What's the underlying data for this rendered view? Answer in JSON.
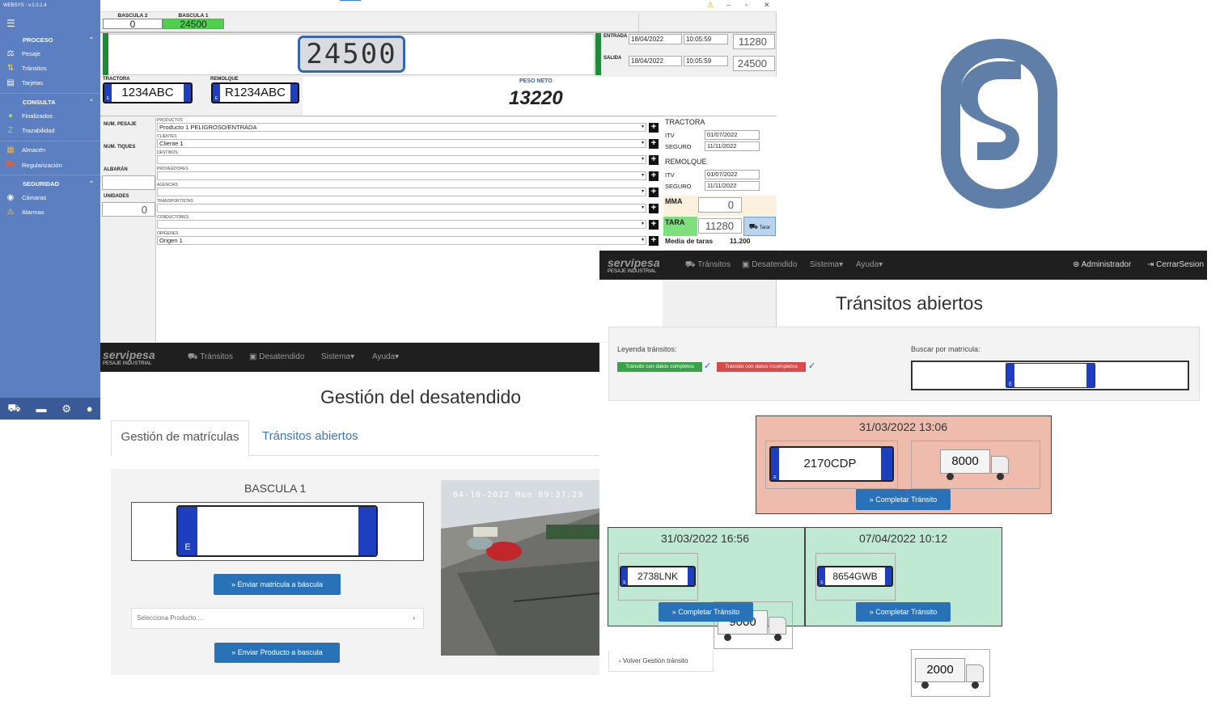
{
  "desktop": {
    "version": "WEBSYS - v.1.0.1.4",
    "sections": {
      "proceso": "PROCESO",
      "consulta": "CONSULTA",
      "seguridad": "SEGURIDAD"
    },
    "menu": {
      "pesaje": "Pesaje",
      "transitos": "Tránsitos",
      "tarjetas": "Tarjetas",
      "finalizados": "Finalizados",
      "trazabilidad": "Trazabilidad",
      "almacen": "Almacén",
      "regularizacion": "Regularización",
      "camaras": "Cámaras",
      "alarmas": "Alarmas"
    },
    "bascula2": {
      "label": "BASCULA 2",
      "value": "0"
    },
    "bascula1": {
      "label": "BASCULA 1",
      "value": "24500"
    },
    "display": "24500",
    "entrada": {
      "label": "ENTRADA",
      "date": "18/04/2022",
      "time": "10:05:59",
      "value": "11280"
    },
    "salida": {
      "label": "SALIDA",
      "date": "18/04/2022",
      "time": "10:05:59",
      "value": "24500"
    },
    "tractora_label": "TRACTORA",
    "tractora_plate": "1234ABC",
    "remolque_label": "REMOLQUE",
    "remolque_plate": "R1234ABC",
    "peso_neto_label": "PESO NETO",
    "peso_neto": "13220",
    "left_labels": {
      "num_pesaje": "NUM. PESAJE",
      "num_tiques": "NUM. TIQUES",
      "albaran": "ALBARÁN",
      "unidades": "UNIDADES"
    },
    "unidades_value": "0",
    "fields": [
      {
        "label": "PRODUCTOS",
        "value": "Producto 1 PELIGROSO/ENTRADA"
      },
      {
        "label": "CLIENTES",
        "value": "Cliente 1"
      },
      {
        "label": "DESTINOS",
        "value": ""
      },
      {
        "label": "PROVEEDORES",
        "value": ""
      },
      {
        "label": "AGENCIAS",
        "value": ""
      },
      {
        "label": "TRANSPORTISTAS",
        "value": ""
      },
      {
        "label": "CONDUCTORES",
        "value": ""
      },
      {
        "label": "ORÍGENES",
        "value": "Origen 1"
      }
    ],
    "right": {
      "tractora": "TRACTORA",
      "remolque": "REMOLQUE",
      "itv": "ITV",
      "seguro": "SEGURO",
      "tractora_itv": "01/07/2022",
      "tractora_seguro": "11/11/2022",
      "remolque_itv": "01/07/2022",
      "remolque_seguro": "11/11/2022",
      "mma": "MMA",
      "mma_value": "0",
      "tara": "TARA",
      "tara_value": "11280",
      "tarar_btn": "Tarar",
      "media_label": "Media de taras",
      "media_value": "11.200"
    }
  },
  "web1": {
    "brand": "servipesa",
    "brand_sub": "PESAJE INDUSTRIAL",
    "nav": [
      "Tránsitos",
      "Desatendido",
      "Sistema▾",
      "Ayuda▾"
    ],
    "title": "Gestión del desatendido",
    "tabs": [
      "Gestión de matrículas",
      "Tránsitos abiertos"
    ],
    "bascula": "BASCULA 1",
    "plate_country": "E",
    "send_plate_btn": "Enviar matricula a báscula",
    "product_placeholder": "Selecciona Producto ...",
    "send_product_btn": "Enviar Producto a bascula",
    "camera_timestamp": "04-10-2022 Mon 09:37:29"
  },
  "web2": {
    "brand": "servipesa",
    "brand_sub": "PESAJE INDUSTRIAL",
    "nav": [
      "Tránsitos",
      "Desatendido",
      "Sistema▾",
      "Ayuda▾"
    ],
    "admin": "Administrador",
    "logout": "CerrarSesion",
    "title": "Tránsitos abiertos",
    "legend_label": "Leyenda tránsitos:",
    "legend_complete": "Tránsito con datos completos",
    "legend_incomplete": "Tránsito con datos incompletos",
    "search_label": "Buscar por matrícula:",
    "plate_country": "E",
    "transits": [
      {
        "date": "31/03/2022 13:06",
        "plate": "2170CDP",
        "weight": "8000",
        "status": "incomplete"
      },
      {
        "date": "31/03/2022 16:56",
        "plate": "2738LNK",
        "weight": "9000",
        "status": "complete"
      },
      {
        "date": "07/04/2022 10:12",
        "plate": "8654GWB",
        "weight": "2000",
        "status": "complete"
      }
    ],
    "complete_btn": "Completar Tránsito",
    "back_btn": "Volver Gestión tránsito"
  },
  "colors": {
    "sidebar": "#5b7fc0",
    "green": "#1f8a38",
    "incomplete_bg": "#eebbad",
    "complete_bg": "#bfe9d2",
    "blue_btn": "#2a72b8",
    "logo": "#5f7fa8"
  }
}
